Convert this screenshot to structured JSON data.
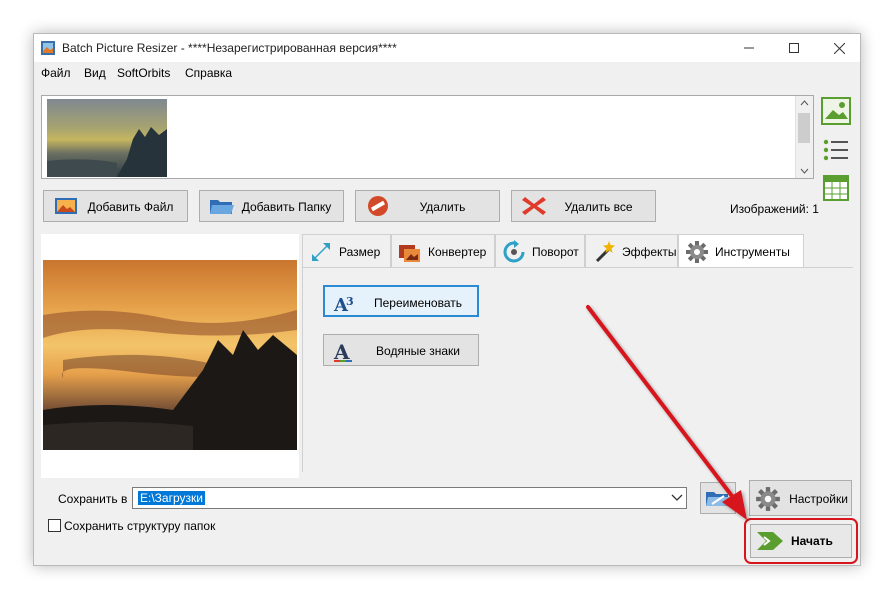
{
  "window": {
    "title": "Batch Picture Resizer - ****Незарегистрированная версия****"
  },
  "menu": [
    "Файл",
    "Вид",
    "SoftOrbits",
    "Справка"
  ],
  "toolbar": {
    "add_file": "Добавить Файл",
    "add_folder": "Добавить Папку",
    "delete": "Удалить",
    "delete_all": "Удалить все"
  },
  "images_count": "Изображений: 1",
  "tabs": [
    {
      "label": "Размер",
      "icon": "resize-icon"
    },
    {
      "label": "Конвертер",
      "icon": "converter-icon"
    },
    {
      "label": "Поворот",
      "icon": "rotate-icon"
    },
    {
      "label": "Эффекты",
      "icon": "effects-wand-icon"
    },
    {
      "label": "Инструменты",
      "icon": "gear-icon"
    }
  ],
  "active_tab": "Инструменты",
  "tools": {
    "rename": "Переименовать",
    "watermarks": "Водяные знаки"
  },
  "save": {
    "label": "Сохранить в",
    "path": "E:\\Загрузки",
    "settings": "Настройки",
    "keep_structure": "Сохранить структуру папок",
    "keep_structure_checked": false
  },
  "start": "Начать",
  "colors": {
    "highlight_red": "#d6151d",
    "selection_blue": "#0078d7",
    "accent_green": "#5a9e2f"
  }
}
